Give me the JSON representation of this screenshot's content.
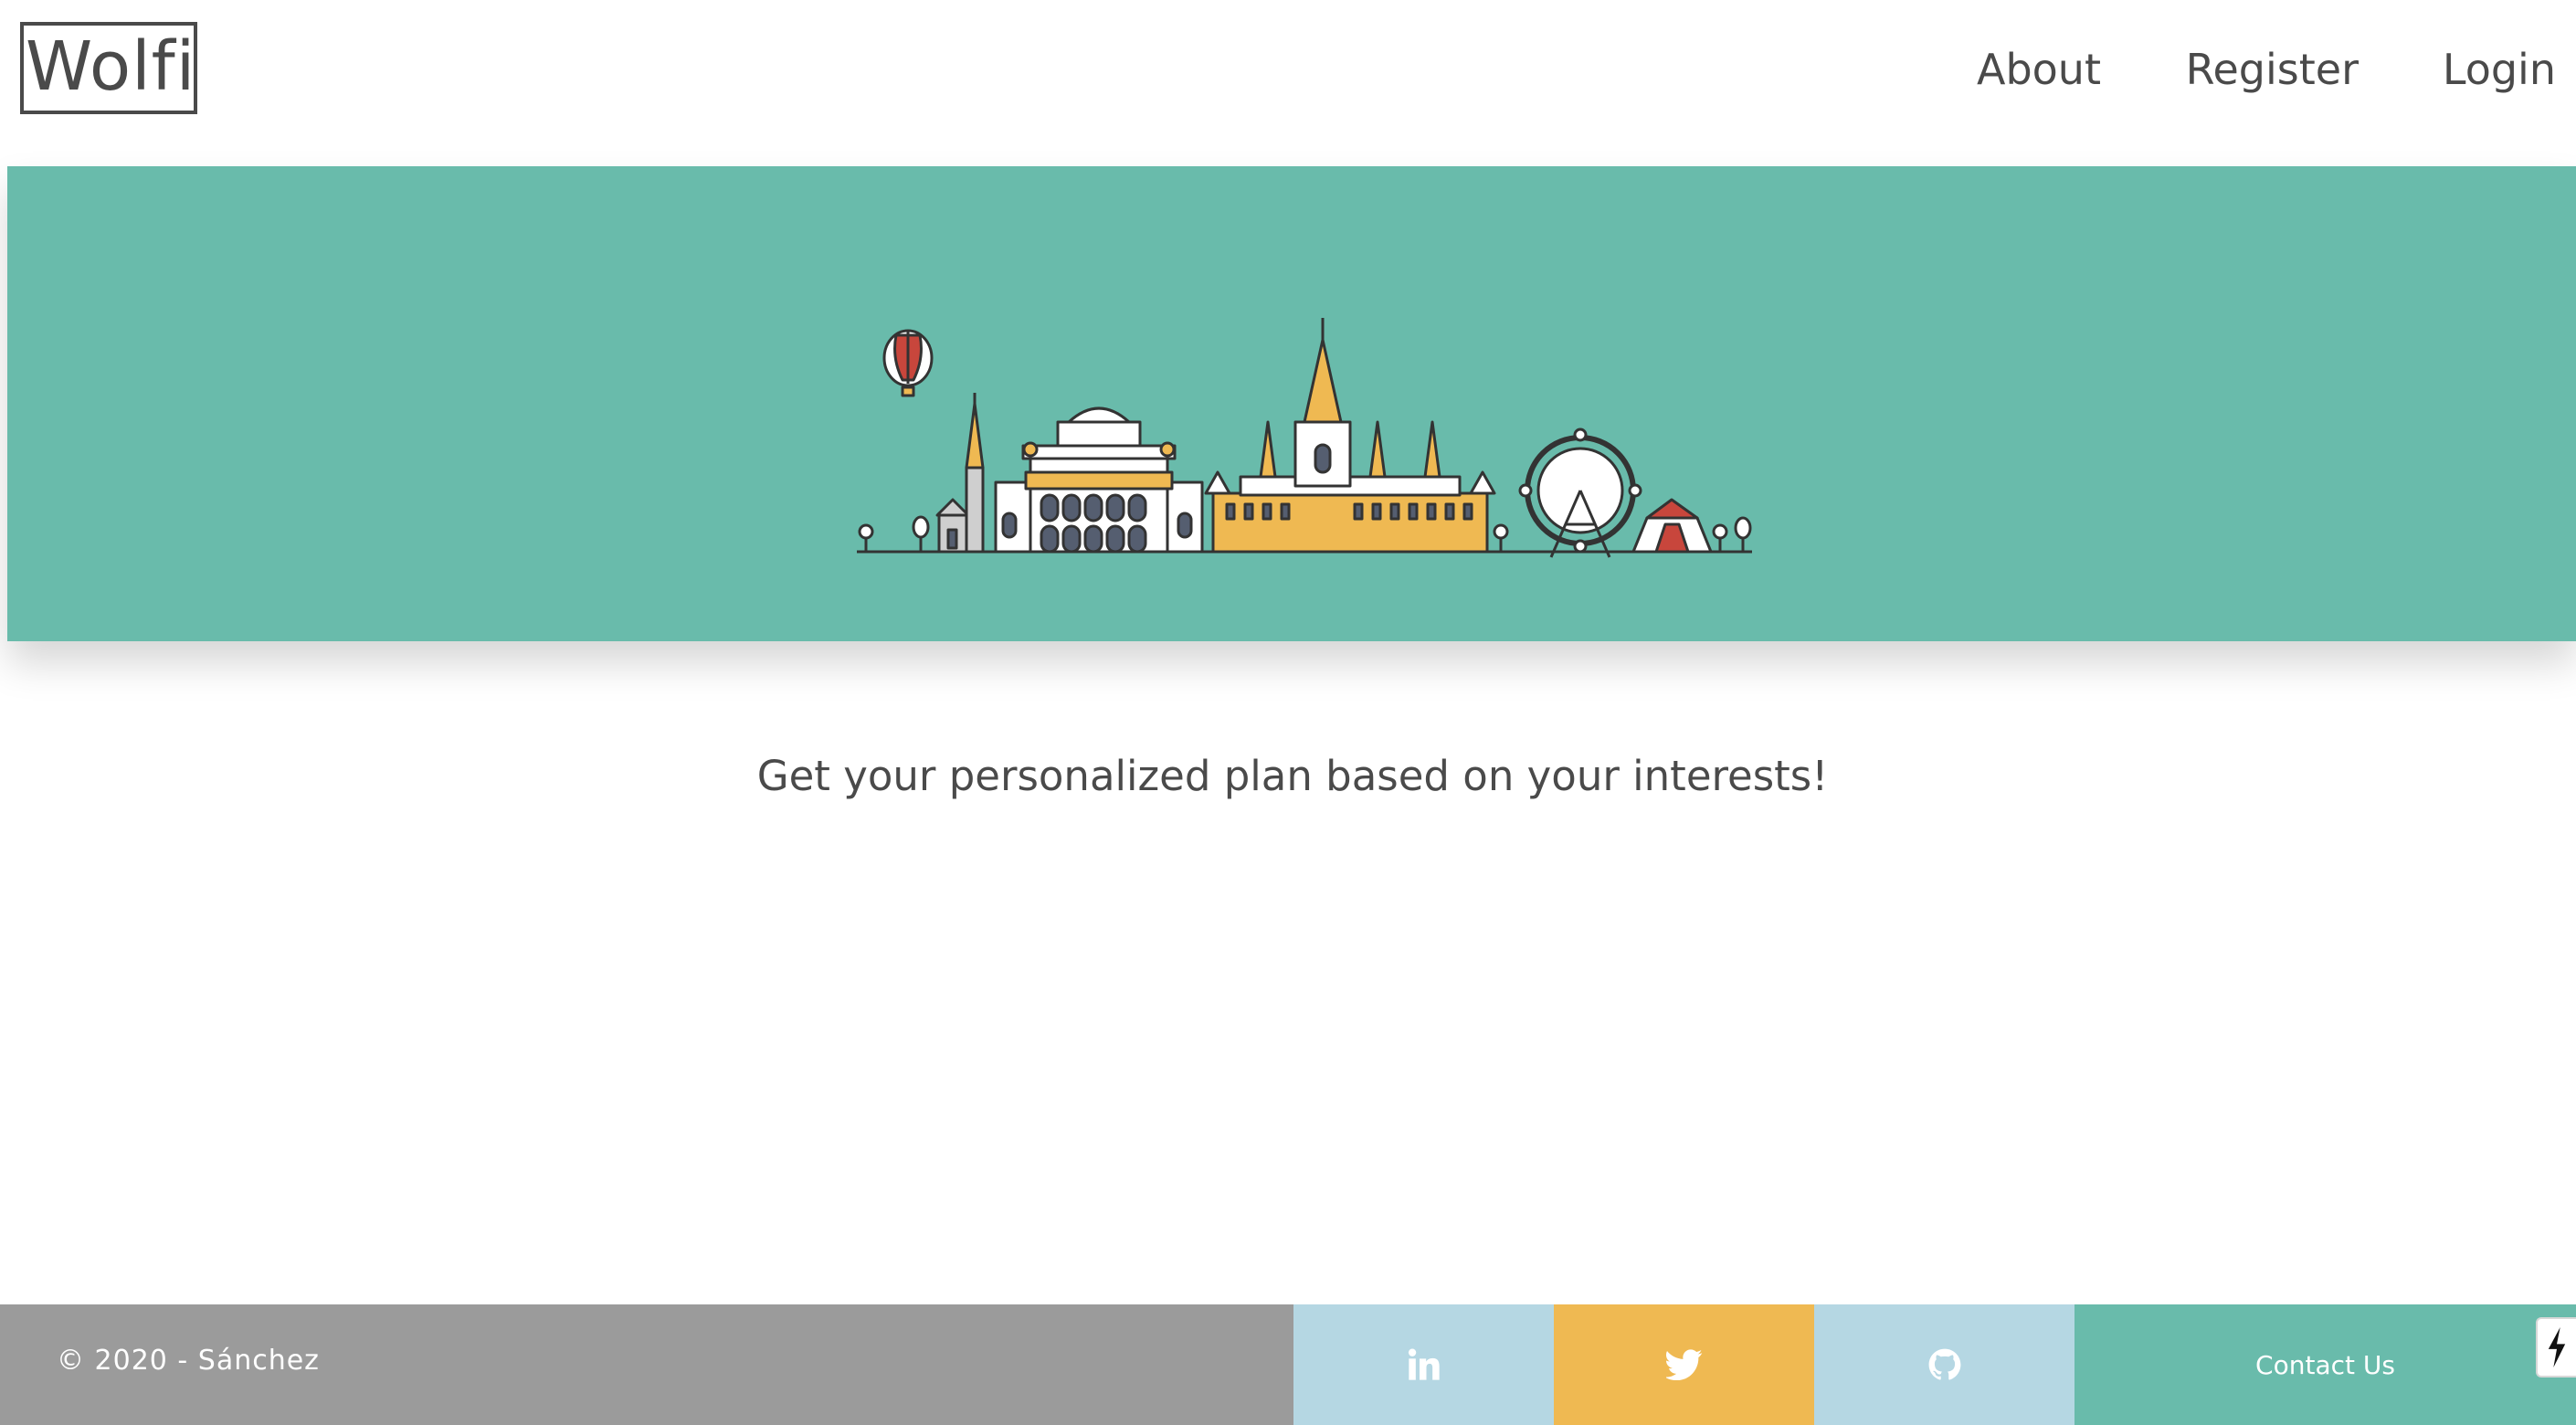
{
  "header": {
    "logo_text": "Wolfi",
    "nav": {
      "about": "About",
      "register": "Register",
      "login": "Login"
    }
  },
  "hero": {
    "illustration": "city-skyline-illustration",
    "background_color": "#69bbab"
  },
  "main": {
    "tagline": "Get your personalized plan based on your interests!"
  },
  "footer": {
    "copyright": "© 2020 - Sánchez",
    "social": [
      {
        "icon": "linkedin-icon",
        "color": "#b5d7e3"
      },
      {
        "icon": "twitter-icon",
        "color": "#efb952"
      },
      {
        "icon": "github-icon",
        "color": "#b5d7e3"
      }
    ],
    "contact_label": "Contact Us",
    "copy_bg_color": "#9b9b9b"
  },
  "widget": {
    "icon": "bolt-icon"
  }
}
